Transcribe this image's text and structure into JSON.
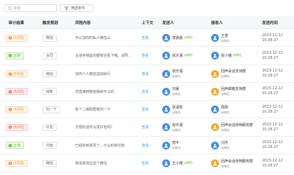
{
  "toolbar": {
    "search_placeholder": "搜索",
    "filter_label": "筛选条件"
  },
  "columns": [
    "审计结果",
    "触发规则",
    "风险内容",
    "上下文",
    "发送人",
    "接收人",
    "发送时间"
  ],
  "rows": [
    {
      "risk": "中风险",
      "level": "mid",
      "rule": "微信",
      "content": "可以加你的私人微信么",
      "context": "查看",
      "sender": {
        "name": "李晨晨",
        "wx": "@微信",
        "sub": "",
        "color": "blue"
      },
      "receiver": {
        "name": "王雪",
        "wx": "",
        "sub": "@微信",
        "color": "blue"
      },
      "date": "2023-12-12",
      "time": "10:28:27"
    },
    {
      "risk": "正常",
      "level": "ok",
      "rule": "合同",
      "content": "合适存档监控都有空看下哦，请导…",
      "context": "查看",
      "sender": {
        "name": "张乐语",
        "wx": "@微信",
        "sub": "",
        "color": "blue"
      },
      "receiver": {
        "name": "张小猫",
        "wx": "@微信",
        "sub": "",
        "color": "blue"
      },
      "date": "2023-12-12",
      "time": "10:28:27"
    },
    {
      "risk": "中风险",
      "level": "mid",
      "rule": "微信",
      "content": "加你个人微信加加就行",
      "context": "查看",
      "sender": {
        "name": "张乐语",
        "wx": "",
        "sub": "@微信",
        "color": "blue"
      },
      "receiver": {
        "name": "回声会话支持群",
        "wx": "",
        "sub": "@微信",
        "color": "orange"
      },
      "date": "2023-12-12",
      "time": "10:28:27"
    },
    {
      "risk": "高风险",
      "level": "high",
      "rule": "转账",
      "content": "您直接转账给我就可以的",
      "context": "查看",
      "sender": {
        "name": "刘夏",
        "wx": "",
        "sub": "@微信",
        "color": "blue"
      },
      "receiver": {
        "name": "回声邮箱支持群",
        "wx": "",
        "sub": "@微信",
        "color": "orange"
      },
      "date": "2023-12-12",
      "time": "10:28:27"
    },
    {
      "risk": "中风险",
      "level": "mid",
      "rule": "扫一下",
      "content": "有个二维码帮我扫一下",
      "context": "查看",
      "sender": {
        "name": "张语哲",
        "wx": "",
        "sub": "@微信",
        "color": "blue"
      },
      "receiver": {
        "name": "陈刚",
        "wx": "",
        "sub": "@微信",
        "color": "blue"
      },
      "date": "2023-12-12",
      "time": "10:28:27"
    },
    {
      "risk": "高风险",
      "level": "high",
      "rule": "红包",
      "content": "方便的话可以发红包吗？",
      "context": "查看",
      "sender": {
        "name": "张乐语",
        "wx": "",
        "sub": "@微信",
        "color": "blue"
      },
      "receiver": {
        "name": "回声会话存档服务群",
        "wx": "",
        "sub": "@微信",
        "color": "orange"
      },
      "date": "2023-12-12",
      "time": "10:28:27"
    },
    {
      "risk": "正常",
      "level": "ok",
      "rule": "付款",
      "content": "已经收到发票了，什么时候付款",
      "context": "查看",
      "sender": {
        "name": "唐平",
        "wx": "",
        "sub": "@微信",
        "color": "blue"
      },
      "receiver": {
        "name": "刘杰",
        "wx": "",
        "sub": "@微信",
        "color": "blue"
      },
      "date": "2023-12-12",
      "time": "10:28:27"
    },
    {
      "risk": "中风险",
      "level": "mid",
      "rule": "微信",
      "content": "我没有加过这个微信",
      "context": "查看",
      "sender": {
        "name": "王小嗖",
        "wx": "@微信",
        "sub": "",
        "color": "blue"
      },
      "receiver": {
        "name": "回声会话存档服务群",
        "wx": "",
        "sub": "@微信",
        "color": "orange"
      },
      "date": "2023-12-12",
      "time": "10:28:27"
    }
  ],
  "colors": {
    "mid": {
      "text": "#e6a23c",
      "bg": "#fdf6ec",
      "border": "#f5dab1"
    },
    "ok": {
      "text": "#67c23a",
      "bg": "#f0f9eb",
      "border": "#c2e7b0"
    },
    "high": {
      "text": "#f56c6c",
      "bg": "#fef0f0",
      "border": "#fbc4c4"
    },
    "link": "#409eff"
  },
  "icons": {
    "search": "search-icon",
    "filter": "filter-icon",
    "avatar": "user-avatar-icon"
  }
}
